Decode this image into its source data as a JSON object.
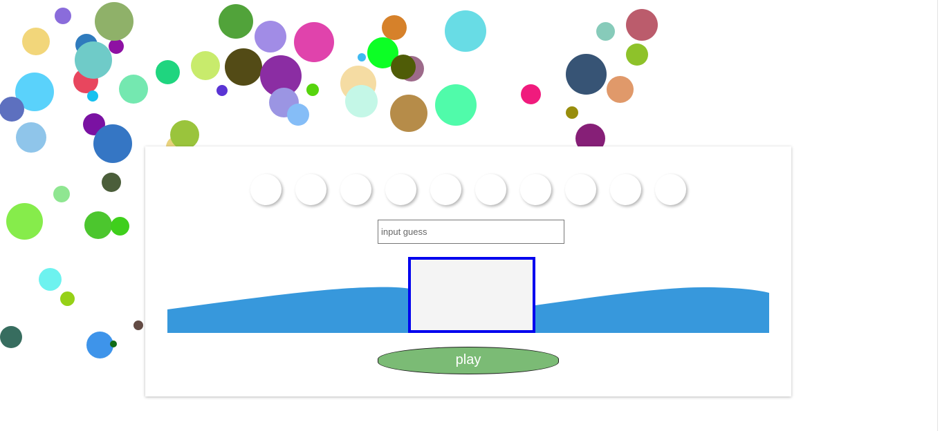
{
  "game": {
    "guess_placeholder": "input guess",
    "guess_value": "",
    "display_value": "",
    "play_label": "play",
    "slot_count": 10
  },
  "colors": {
    "wave": "#3798dc",
    "display_border": "#0000ee",
    "display_fill": "#f4f4f4",
    "play_button": "#7bbb75",
    "play_text": "#ffffff"
  },
  "bubble_colors": [
    "#8a6cdb",
    "#f2d67a",
    "#2f7bbd",
    "#8e11a3",
    "#e8465e",
    "#6fcbc8",
    "#8fb169",
    "#5ad2fb",
    "#17c1ef",
    "#5d70bf",
    "#8fc5ea",
    "#7a12a2",
    "#3576c4",
    "#4b5e3a",
    "#8fe691",
    "#86ec4b",
    "#4cc62e",
    "#3fcf1c",
    "#6df2ef",
    "#96d117",
    "#376d5f",
    "#3e94ea",
    "#116d16",
    "#634b44",
    "#74e8b0",
    "#1fd57f",
    "#c8eb6c",
    "#e8d27e",
    "#9ac43c",
    "#5a34d4",
    "#51a33a",
    "#534b16",
    "#a18ce6",
    "#8b2da3",
    "#9b95e3",
    "#85bdf7",
    "#e043ac",
    "#56d40d",
    "#f5dca3",
    "#c4f7e7",
    "#3fb9f2",
    "#d6812a",
    "#0cff25",
    "#9d6a8a",
    "#4f5c07",
    "#b68c49",
    "#50fbaa",
    "#68dce5",
    "#f01b7d",
    "#375475",
    "#988d0c",
    "#861f77",
    "#e0996a",
    "#87cbba",
    "#bb5c6c",
    "#8ec22a"
  ]
}
